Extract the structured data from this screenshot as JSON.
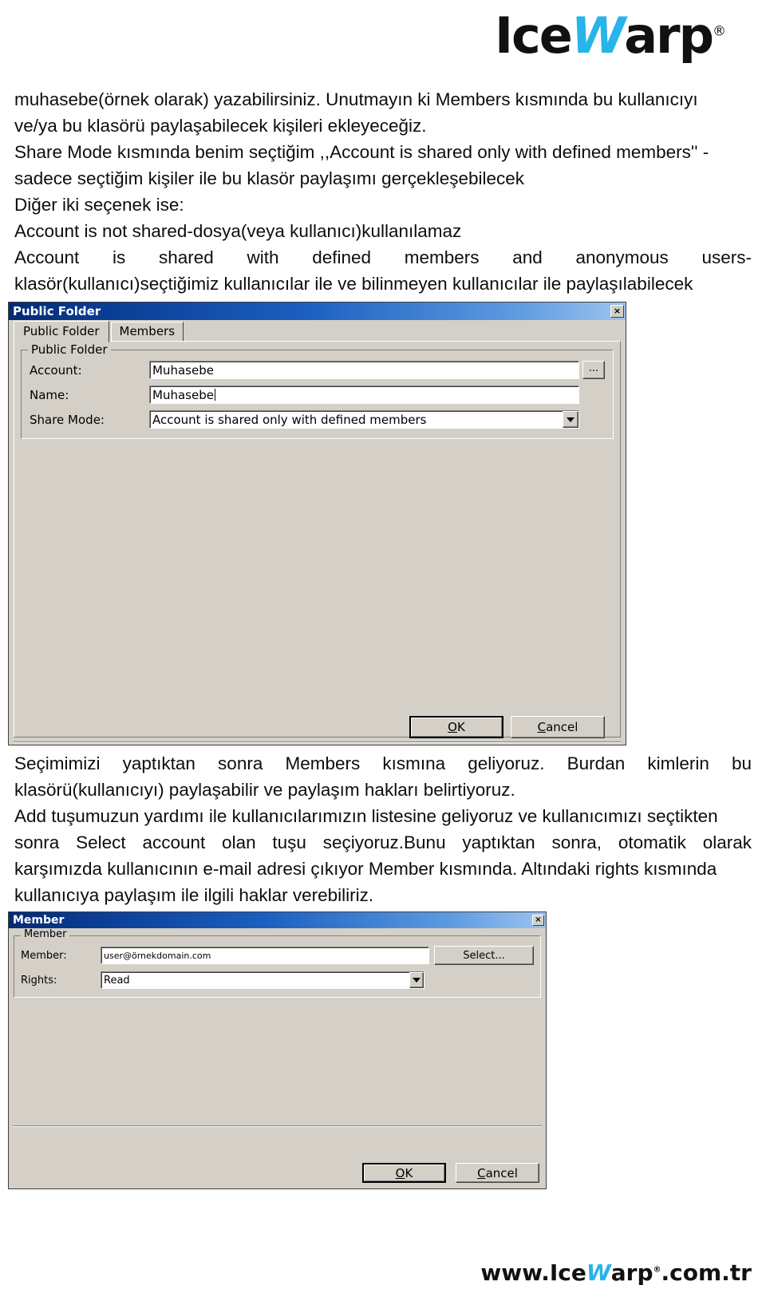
{
  "brand": {
    "logo_pre": "Ice",
    "logo_w": "W",
    "logo_post": "arp",
    "registered": "®",
    "footer_pre": "www.Ice",
    "footer_w": "W",
    "footer_post": "arp",
    "footer_tld": ".com.tr",
    "accent_color": "#27b4e8"
  },
  "prose": {
    "p1": "muhasebe(örnek olarak) yazabilirsiniz. Unutmayın ki Members kısmında bu kullanıcıyı",
    "p2": "ve/ya bu klasörü paylaşabilecek kişileri ekleyeceğiz.",
    "p3": "Share Mode kısmında benim seçtiğim ,,Account is shared only with defined members'' -",
    "p4": "sadece seçtiğim kişiler ile bu klasör paylaşımı gerçekleşebilecek",
    "p5": "Diğer iki seçenek ise:",
    "p6": "Account is not shared-dosya(veya kullanıcı)kullanılamaz",
    "p7": "Account is shared with defined members and anonymous users-",
    "p8": "klasör(kullanıcı)seçtiğimiz kullanıcılar ile ve bilinmeyen kullanıcılar ile paylaşılabilecek",
    "p9": "Seçimimizi yaptıktan sonra Members kısmına geliyoruz. Burdan kimlerin bu",
    "p10": "klasörü(kullanıcıyı) paylaşabilir ve paylaşım hakları belirtiyoruz.",
    "p11": "Add tuşumuzun yardımı ile kullanıcılarımızın listesine geliyoruz ve kullanıcımızı seçtikten",
    "p12": "sonra Select account olan tuşu seçiyoruz.Bunu yaptıktan sonra, otomatik olarak",
    "p13": "karşımızda kullanıcının e-mail adresi çıkıyor Member kısmında. Altındaki rights kısmında",
    "p14": "kullanıcıya paylaşım ile ilgili haklar verebiliriz."
  },
  "public_folder_dialog": {
    "title": "Public Folder",
    "close_label": "×",
    "tabs": [
      {
        "label": "Public Folder",
        "active": true
      },
      {
        "label": "Members",
        "active": false
      }
    ],
    "group_legend": "Public Folder",
    "fields": {
      "account_label": "Account:",
      "account_value": "Muhasebe",
      "browse_label": "...",
      "name_label": "Name:",
      "name_value": "Muhasebe",
      "share_mode_label": "Share Mode:",
      "share_mode_value": "Account is shared only with defined members"
    },
    "buttons": {
      "ok_mnemonic": "O",
      "ok_rest": "K",
      "cancel_mnemonic": "C",
      "cancel_rest": "ancel"
    }
  },
  "member_dialog": {
    "title": "Member",
    "close_label": "×",
    "group_legend": "Member",
    "fields": {
      "member_label": "Member:",
      "member_value": "user@örnekdomain.com",
      "select_label": "Select...",
      "rights_label": "Rights:",
      "rights_value": "Read"
    },
    "buttons": {
      "ok_mnemonic": "O",
      "ok_rest": "K",
      "cancel_mnemonic": "C",
      "cancel_rest": "ancel"
    }
  }
}
